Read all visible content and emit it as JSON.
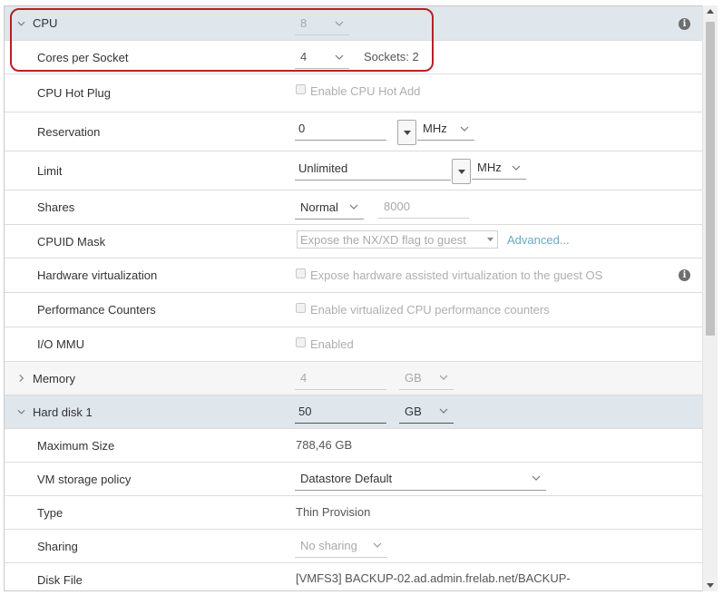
{
  "cpu": {
    "label": "CPU",
    "value": "8",
    "cores_per_socket": {
      "label": "Cores per Socket",
      "value": "4",
      "sockets_text": "Sockets: 2"
    },
    "hot_plug": {
      "label": "CPU Hot Plug",
      "checkbox_label": "Enable CPU Hot Add"
    },
    "reservation": {
      "label": "Reservation",
      "value": "0",
      "unit": "MHz"
    },
    "limit": {
      "label": "Limit",
      "value": "Unlimited",
      "unit": "MHz"
    },
    "shares": {
      "label": "Shares",
      "level": "Normal",
      "value": "8000"
    },
    "cpuid_mask": {
      "label": "CPUID Mask",
      "selected": "Expose the NX/XD flag to guest",
      "link": "Advanced..."
    },
    "hw_virt": {
      "label": "Hardware virtualization",
      "checkbox_label": "Expose hardware assisted virtualization to the guest OS"
    },
    "perf_counters": {
      "label": "Performance Counters",
      "checkbox_label": "Enable virtualized CPU performance counters"
    },
    "iommu": {
      "label": "I/O MMU",
      "checkbox_label": "Enabled"
    }
  },
  "memory": {
    "label": "Memory",
    "value": "4",
    "unit": "GB"
  },
  "hard_disk": {
    "label": "Hard disk 1",
    "value": "50",
    "unit": "GB",
    "max_size": {
      "label": "Maximum Size",
      "value": "788,46 GB"
    },
    "storage_policy": {
      "label": "VM storage policy",
      "value": "Datastore Default"
    },
    "type": {
      "label": "Type",
      "value": "Thin Provision"
    },
    "sharing": {
      "label": "Sharing",
      "value": "No sharing"
    },
    "disk_file": {
      "label": "Disk File",
      "value": "[VMFS3] BACKUP-02.ad.admin.frelab.net/BACKUP-"
    }
  },
  "colors": {
    "header_bg": "#dfe6ec",
    "highlight": "#b52027",
    "link": "#6aa7c9"
  }
}
